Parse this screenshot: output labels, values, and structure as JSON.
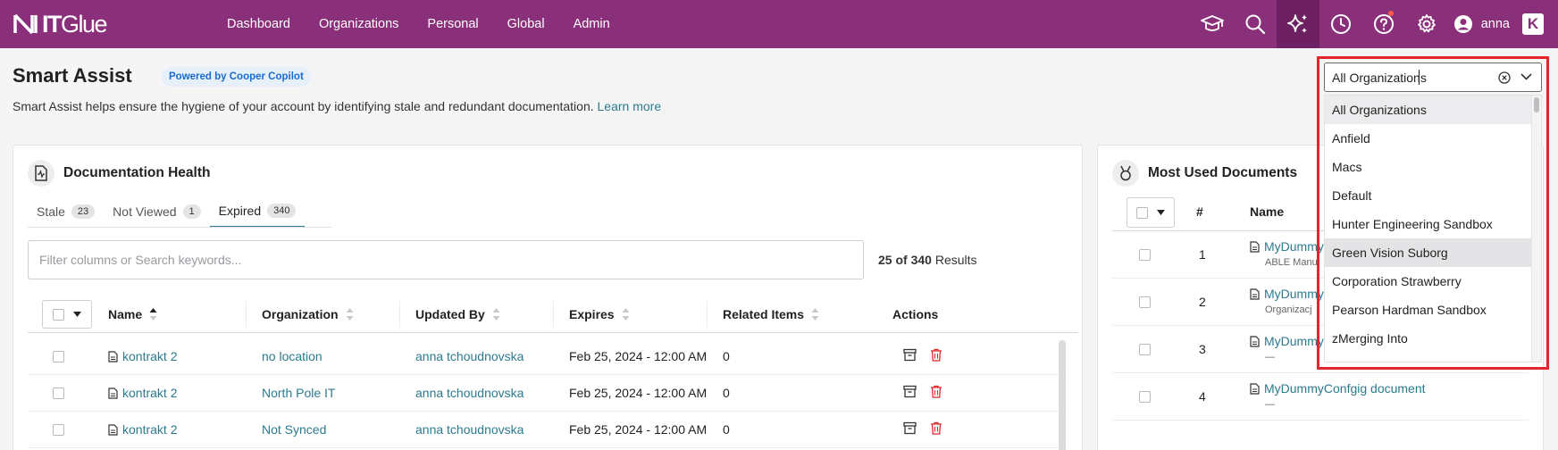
{
  "nav": {
    "logo_it": "IT",
    "logo_glue": "Glue",
    "links": [
      "Dashboard",
      "Organizations",
      "Personal",
      "Global",
      "Admin"
    ],
    "icons": [
      "graduation-cap-icon",
      "search-icon",
      "sparkle-icon",
      "clock-icon",
      "help-icon",
      "gear-icon"
    ],
    "user_name": "anna",
    "k_badge": "K",
    "brand_color": "#8a2f7a"
  },
  "header": {
    "title": "Smart Assist",
    "badge": "Powered by Cooper Copilot",
    "description": "Smart Assist helps ensure the hygiene of your account by identifying stale and redundant documentation.",
    "learn_more": "Learn more"
  },
  "health": {
    "title": "Documentation Health",
    "tabs": [
      {
        "label": "Stale",
        "count": "23"
      },
      {
        "label": "Not Viewed",
        "count": "1"
      },
      {
        "label": "Expired",
        "count": "340"
      }
    ],
    "active_tab": "Expired",
    "search_placeholder": "Filter columns or Search keywords...",
    "results_count": "25 of 340",
    "results_label": "Results",
    "columns": [
      "Name",
      "Organization",
      "Updated By",
      "Expires",
      "Related Items",
      "Actions"
    ],
    "rows": [
      {
        "name": "kontrakt 2",
        "organization": "no location",
        "updated_by": "anna tchoudnovska",
        "expires": "Feb 25, 2024 - 12:00 AM",
        "related": "0"
      },
      {
        "name": "kontrakt 2",
        "organization": "North Pole IT",
        "updated_by": "anna tchoudnovska",
        "expires": "Feb 25, 2024 - 12:00 AM",
        "related": "0"
      },
      {
        "name": "kontrakt 2",
        "organization": "Not Synced",
        "updated_by": "anna tchoudnovska",
        "expires": "Feb 25, 2024 - 12:00 AM",
        "related": "0"
      }
    ]
  },
  "most_used": {
    "title": "Most Used Documents",
    "columns": [
      "#",
      "Name"
    ],
    "rows": [
      {
        "num": "1",
        "name": "MyDummy",
        "sub": "ABLE Manu"
      },
      {
        "num": "2",
        "name": "MyDummy",
        "sub": "Organizacj"
      },
      {
        "num": "3",
        "name": "MyDummyConfgig document",
        "sub": "—"
      },
      {
        "num": "4",
        "name": "MyDummyConfgig document",
        "sub": "—"
      }
    ]
  },
  "org_dropdown": {
    "value": "All Organizations",
    "options": [
      "All Organizations",
      "Anfield",
      "Macs",
      "Default",
      "Hunter Engineering Sandbox",
      "Green Vision Suborg",
      "Corporation Strawberry",
      "Pearson Hardman Sandbox",
      "zMerging Into"
    ],
    "selected": "All Organizations",
    "hovered": "Green Vision Suborg",
    "highlight_color": "#e3262c"
  }
}
